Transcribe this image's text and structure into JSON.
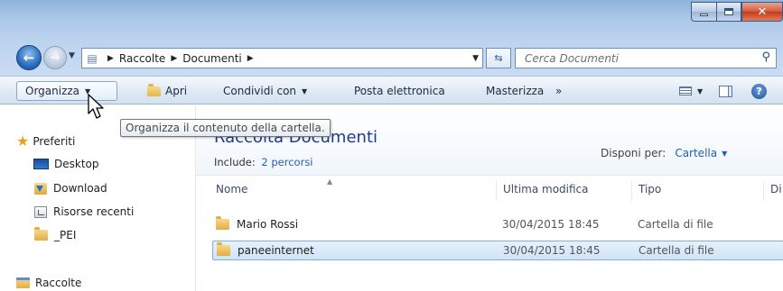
{
  "address": {
    "crumbs": [
      "Raccolte",
      "Documenti"
    ]
  },
  "search": {
    "placeholder": "Cerca Documenti"
  },
  "toolbar": {
    "organize": "Organizza",
    "open": "Apri",
    "share": "Condividi con",
    "email": "Posta elettronica",
    "burn": "Masterizza",
    "more": "»"
  },
  "tooltip": {
    "text": "Organizza il contenuto della cartella."
  },
  "nav": {
    "favorites": "Preferiti",
    "items": [
      "Desktop",
      "Download",
      "Risorse recenti",
      "_PEI"
    ],
    "libraries": "Raccolte"
  },
  "library": {
    "title": "Raccolta Documenti",
    "include_label": "Include:",
    "include_link": "2 percorsi",
    "arrange_label": "Disponi per:",
    "arrange_value": "Cartella"
  },
  "columns": {
    "name": "Nome",
    "modified": "Ultima modifica",
    "type": "Tipo",
    "size": "Di"
  },
  "files": [
    {
      "name": "Mario Rossi",
      "modified": "30/04/2015 18:45",
      "type": "Cartella di file"
    },
    {
      "name": "paneeinternet",
      "modified": "30/04/2015 18:45",
      "type": "Cartella di file"
    }
  ],
  "colors": {
    "title_blue": "#1e3a8a",
    "link_blue": "#1f5fb8",
    "selection": "#cfe3f8"
  }
}
